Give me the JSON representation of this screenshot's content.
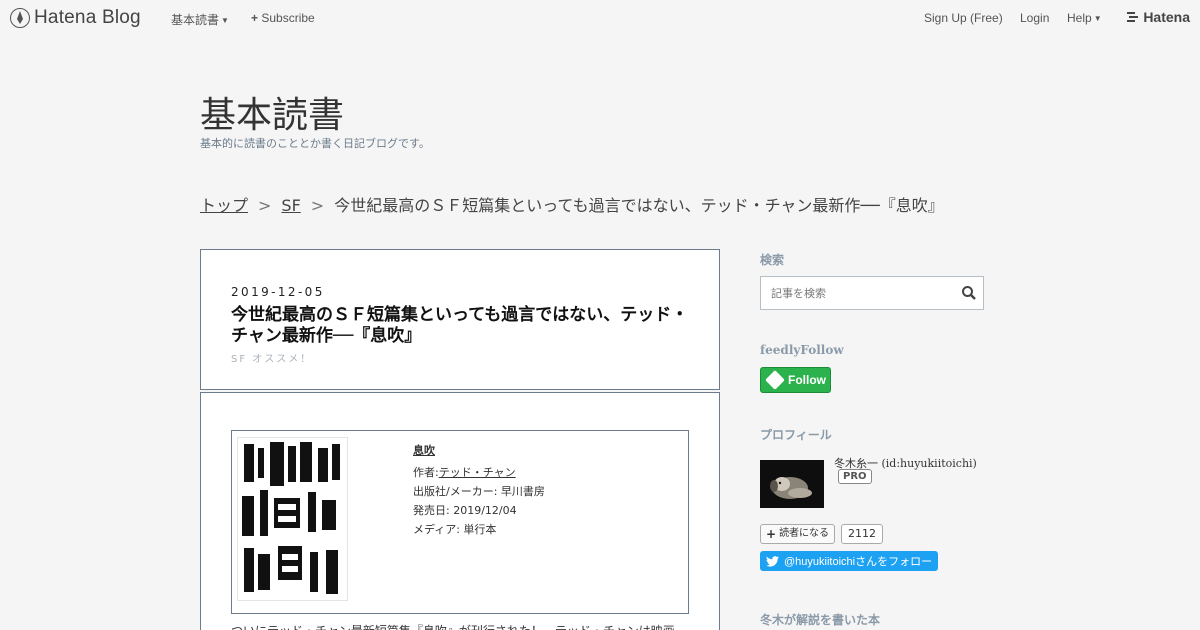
{
  "topbar": {
    "brand": "Hatena Blog",
    "reading_menu": "基本読書",
    "subscribe": "Subscribe",
    "signup": "Sign Up (Free)",
    "login": "Login",
    "help": "Help",
    "hatena": "Hatena"
  },
  "blog": {
    "title": "基本読書",
    "description": "基本的に読書のこととか書く日記ブログです。"
  },
  "breadcrumb": {
    "top": "トップ",
    "category": "SF",
    "current": "今世紀最高のＳＦ短篇集といっても過言ではない、テッド・チャン最新作──『息吹』",
    "separator": ">"
  },
  "entry": {
    "date": "2019-12-05",
    "title": "今世紀最高のＳＦ短篇集といっても過言ではない、テッド・チャン最新作──『息吹』",
    "categories": "SF  オススメ！",
    "product": {
      "name": "息吹",
      "author_label": "作者:",
      "author": "テッド・チャン",
      "publisher": "出版社/メーカー: 早川書房",
      "release": "発売日: 2019/12/04",
      "media": "メディア: 単行本"
    },
    "body_start": "ついにテッド・チャン最新短篇集『息吹』が刊行された！　テッド・チャンは映画"
  },
  "sidebar": {
    "search_heading": "検索",
    "search_placeholder": "記事を検索",
    "feedly_heading": "feedlyFollow",
    "feedly_button": "Follow",
    "profile_heading": "プロフィール",
    "profile_name": "冬木糸一 (id:huyukiitoichi)",
    "pro_badge": "PRO",
    "reader_button": "読者になる",
    "reader_count": "2112",
    "twitter_button": "@huyukiitoichiさんをフォロー",
    "books_heading": "冬木が解説を書いた本"
  },
  "colors": {
    "accent": "#6b7b8c",
    "feedly_green": "#2bb24c",
    "twitter_blue": "#1da1f2"
  }
}
